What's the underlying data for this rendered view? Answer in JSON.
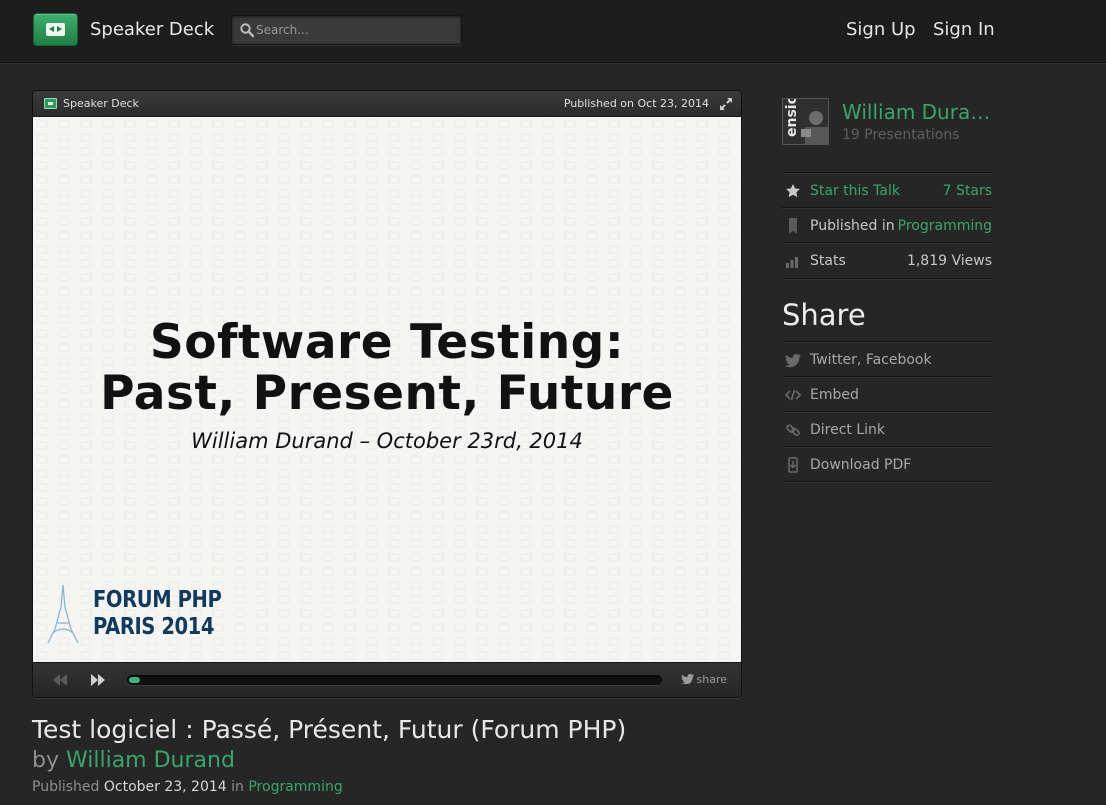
{
  "header": {
    "brand": "Speaker Deck",
    "search_placeholder": "Search...",
    "signup_label": "Sign Up",
    "signin_label": "Sign In"
  },
  "player": {
    "brand": "Speaker Deck",
    "published": "Published on Oct 23, 2014",
    "share_label": "share",
    "progress_fraction": 0.02,
    "slide": {
      "title_line1": "Software Testing:",
      "title_line2": "Past, Present, Future",
      "subtitle": "William Durand – October 23rd, 2014",
      "logo_line1": "FORUM PHP",
      "logo_line2": "PARIS 2014"
    }
  },
  "talk": {
    "title": "Test logiciel : Passé, Présent, Futur (Forum PHP)",
    "by_prefix": "by",
    "author": "William Durand",
    "published_prefix": "Published",
    "published_date": "October 23, 2014",
    "in_label": "in",
    "category": "Programming"
  },
  "sidebar": {
    "author_name": "William Dura…",
    "presentations": "19 Presentations",
    "rows": [
      {
        "icon": "star-icon",
        "label": "Star this Talk",
        "value": "7 Stars"
      },
      {
        "icon": "bookmark-icon",
        "label": "Published in",
        "value": "Programming"
      },
      {
        "icon": "stats-icon",
        "label": "Stats",
        "value": "1,819 Views"
      }
    ],
    "share_heading": "Share",
    "share_items": [
      {
        "icon": "twitter-icon",
        "label": "Twitter, Facebook"
      },
      {
        "icon": "embed-icon",
        "label": "Embed"
      },
      {
        "icon": "link-icon",
        "label": "Direct Link"
      },
      {
        "icon": "download-icon",
        "label": "Download PDF"
      }
    ]
  },
  "colors": {
    "accent": "#3aa56a",
    "background": "#262626",
    "header": "#1d1d1d"
  }
}
